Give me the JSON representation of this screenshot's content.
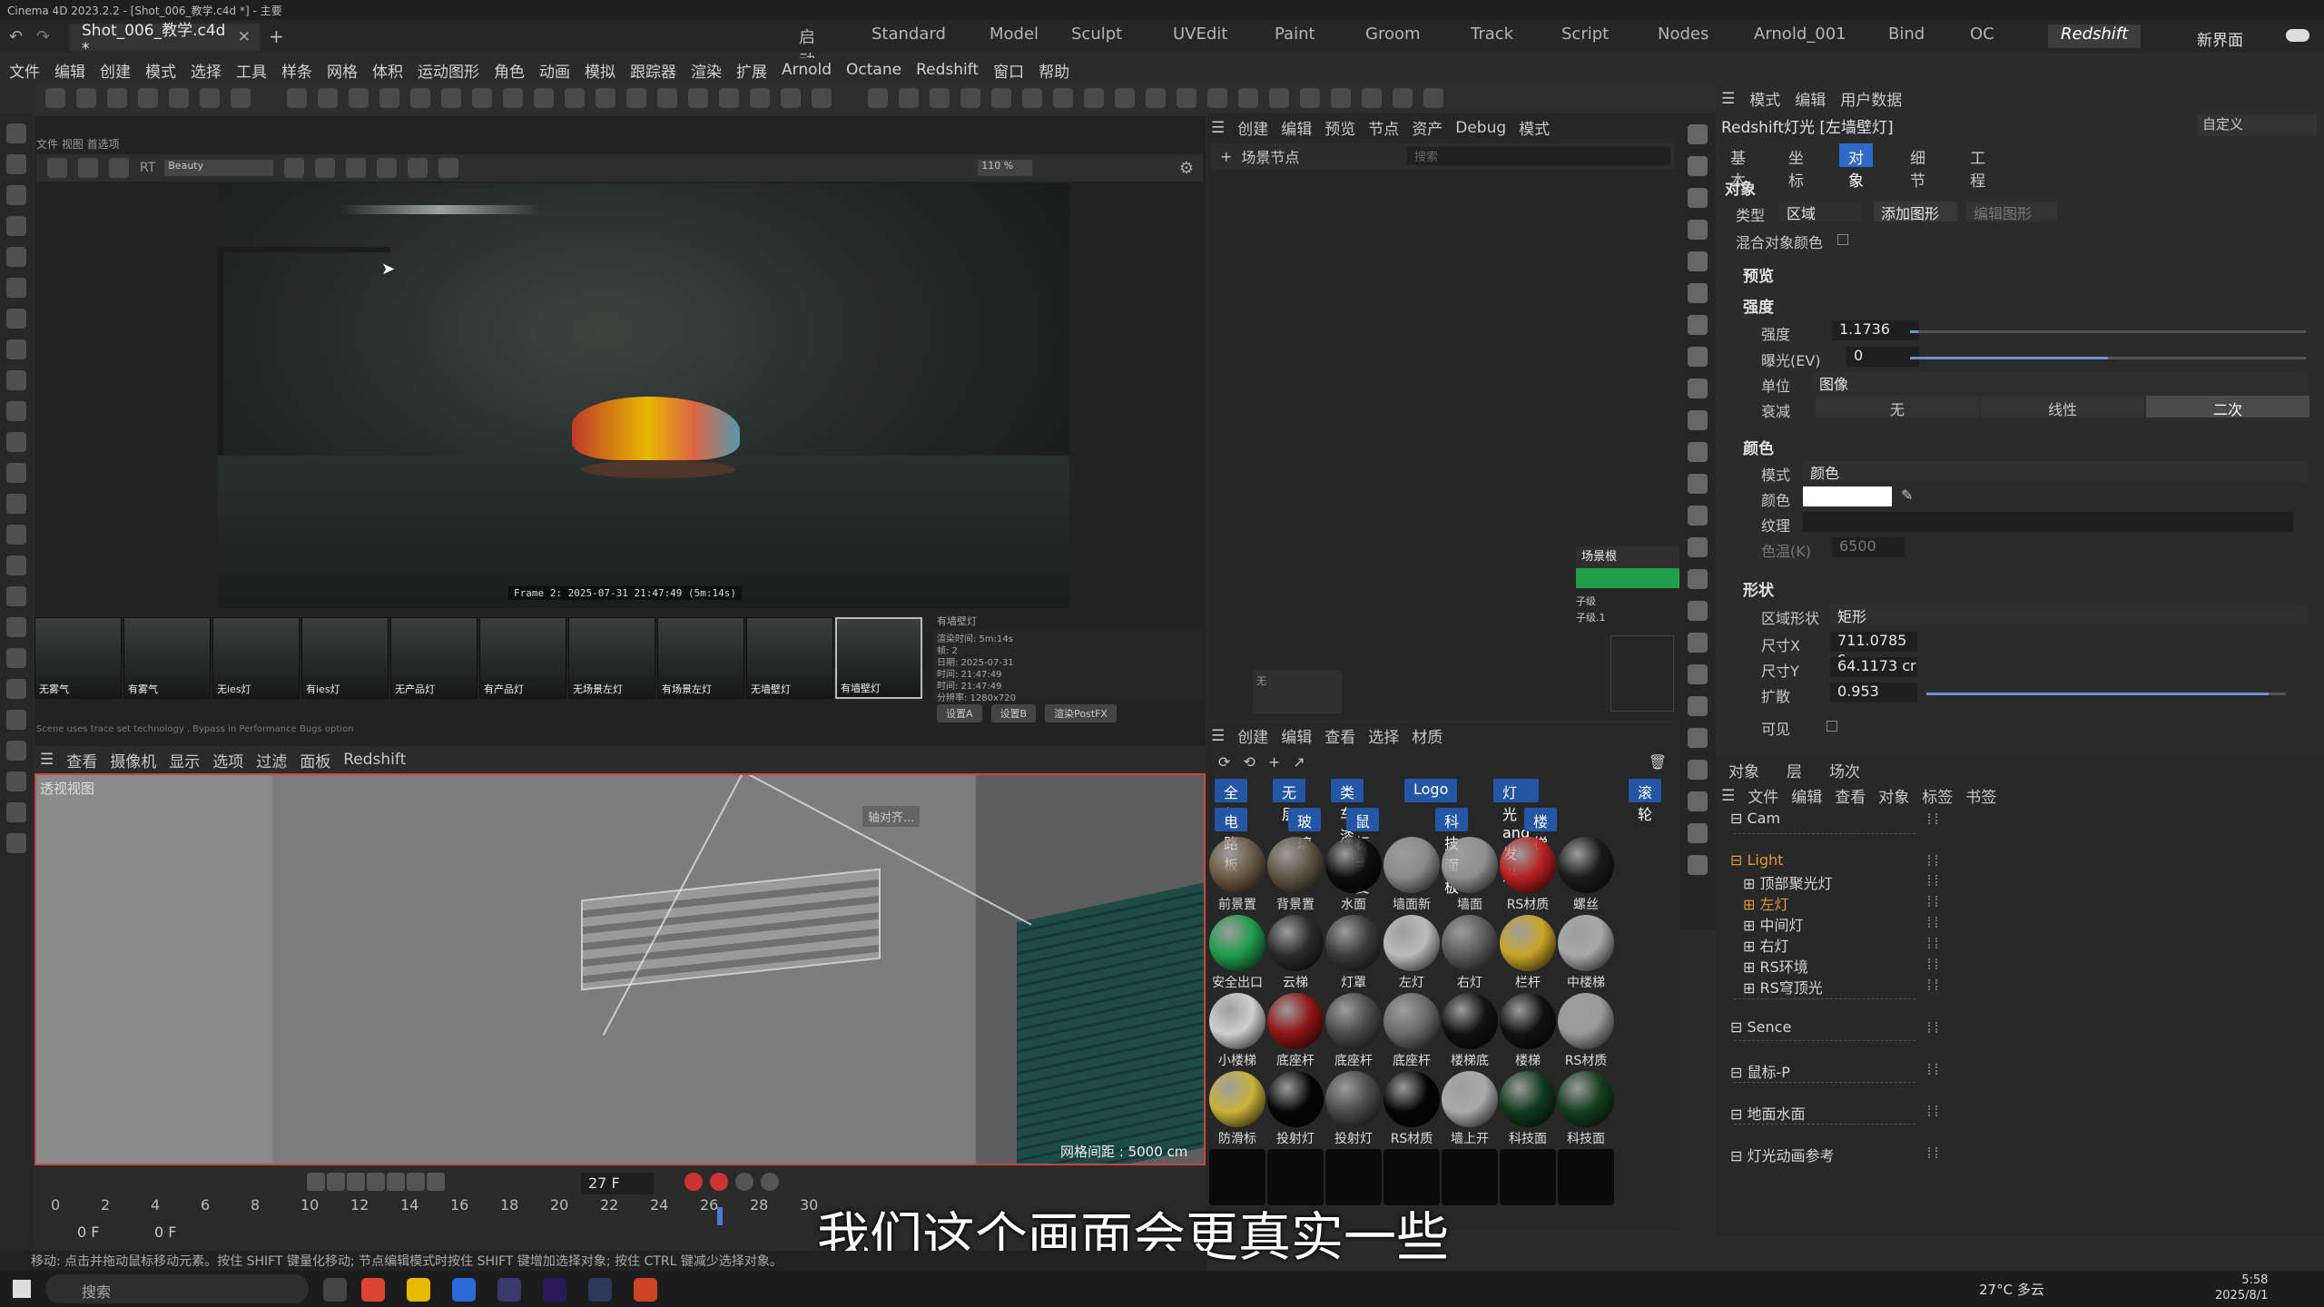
{
  "window": {
    "title": "Cinema 4D 2023.2.2 - [Shot_006_教学.c4d *] - 主要",
    "doc_tab": "Shot_006_教学.c4d *"
  },
  "layouts": [
    "启动",
    "Standard",
    "Model",
    "Sculpt",
    "UVEdit",
    "Paint",
    "Groom",
    "Track",
    "Script",
    "Nodes",
    "Arnold_001",
    "Bind",
    "OC",
    "Redshift"
  ],
  "active_layout": "Redshift",
  "new_interface": "新界面",
  "menu": [
    "文件",
    "编辑",
    "创建",
    "模式",
    "选择",
    "工具",
    "样条",
    "网格",
    "体积",
    "运动图形",
    "角色",
    "动画",
    "模拟",
    "跟踪器",
    "渲染",
    "扩展",
    "Arnold",
    "Octane",
    "Redshift",
    "窗口",
    "帮助"
  ],
  "render_view": {
    "menu": "文件 视图 首选项",
    "aov": "Beauty",
    "zoom": "110 %",
    "frame_label": "Frame  2:  2025-07-31  21:47:49  (5m:14s)",
    "snapshot_label": "有墙壁灯",
    "snapshot_info": [
      "有墙壁灯",
      "渲染时间: 5m:14s",
      "帧: 2",
      "日期: 2025-07-31",
      "时间: 21:47:49",
      "时间: 21:47:49",
      "分辨率: 1280x720"
    ],
    "snapshot_buttons": [
      "设置A",
      "设置B",
      "渲染PostFX"
    ],
    "thumbs": [
      "无雾气",
      "有雾气",
      "无ies灯",
      "有ies灯",
      "无产品灯",
      "有产品灯",
      "无场景左灯",
      "有场景左灯",
      "无墙壁灯",
      "有墙壁灯"
    ],
    "status": "Scene uses trace set technology . Bypass in Performance Bugs option"
  },
  "viewport": {
    "menu": [
      "查看",
      "摄像机",
      "显示",
      "选项",
      "过滤",
      "面板",
      "Redshift"
    ],
    "title": "透视视图",
    "axis_label": "轴对齐...",
    "grid": "网格间距 : 5000 cm"
  },
  "timeline": {
    "current_frame": "27 F",
    "ticks": [
      "0",
      "2",
      "4",
      "6",
      "8",
      "10",
      "12",
      "14",
      "16",
      "18",
      "20",
      "22",
      "24",
      "26",
      "28",
      "30"
    ],
    "start": "0 F",
    "end": "0 F"
  },
  "node_editor": {
    "menu": [
      "创建",
      "编辑",
      "预览",
      "节点",
      "资产",
      "Debug",
      "模式"
    ],
    "header": "场景节点",
    "search_placeholder": "搜索",
    "root_node": "场景根",
    "children": [
      "子级",
      "子级.1"
    ],
    "thumb_label": "无"
  },
  "material_manager": {
    "menu": [
      "创建",
      "编辑",
      "查看",
      "选择",
      "材质"
    ],
    "tabs_row1": [
      "全部",
      "无层",
      "类车漆",
      "Logo",
      "灯光and发光",
      "滚轮"
    ],
    "tabs_row2": [
      "电路板",
      "玻璃",
      "鼠标主要",
      "科技面板",
      "楼梯"
    ],
    "materials": [
      {
        "name": "前景置",
        "color": "#6b5a44"
      },
      {
        "name": "背景置",
        "color": "#5e5443"
      },
      {
        "name": "水面",
        "color": "#0d0d0d"
      },
      {
        "name": "墙面新",
        "color": "#8a8a8a"
      },
      {
        "name": "墙面",
        "color": "#909090"
      },
      {
        "name": "RS材质",
        "color": "#b51f1f"
      },
      {
        "name": "螺丝",
        "color": "#1a1a1a"
      },
      {
        "name": "安全出口",
        "color": "#1e9c4a"
      },
      {
        "name": "云梯",
        "color": "#2a2a2a"
      },
      {
        "name": "灯罩",
        "color": "#3a3a3a"
      },
      {
        "name": "左灯",
        "color": "#bcbcbc"
      },
      {
        "name": "右灯",
        "color": "#5a5a5a"
      },
      {
        "name": "栏杆",
        "color": "#c9a326"
      },
      {
        "name": "中楼梯",
        "color": "#a8a8a8"
      },
      {
        "name": "小楼梯",
        "color": "#cfcfcf"
      },
      {
        "name": "底座杆",
        "color": "#8f1414"
      },
      {
        "name": "底座杆",
        "color": "#4a4a4a"
      },
      {
        "name": "底座杆",
        "color": "#6a6a6a"
      },
      {
        "name": "楼梯底",
        "color": "#121212"
      },
      {
        "name": "楼梯",
        "color": "#111111"
      },
      {
        "name": "RS材质",
        "color": "#9a9a9a"
      },
      {
        "name": "防滑标",
        "color": "#c9b23a"
      },
      {
        "name": "投射灯",
        "color": "#050505"
      },
      {
        "name": "投射灯",
        "color": "#4a4a4a"
      },
      {
        "name": "RS材质",
        "color": "#050505"
      },
      {
        "name": "墙上开",
        "color": "#aaaaaa"
      },
      {
        "name": "科技面",
        "color": "#123a1c"
      },
      {
        "name": "科技面",
        "color": "#143e1e"
      }
    ]
  },
  "attributes": {
    "menu": [
      "模式",
      "编辑",
      "用户数据"
    ],
    "title": "Redshift灯光 [左墙壁灯]",
    "preset": "自定义",
    "tabs": [
      "基本",
      "坐标",
      "对象",
      "细节",
      "工程"
    ],
    "active_tab": "对象",
    "section_object": "对象",
    "type_label": "类型",
    "type_value": "区域",
    "add_shape": "添加图形",
    "edit_shape": "编辑图形",
    "mix_color": "混合对象颜色",
    "preview": "预览",
    "intensity_section": "强度",
    "intensity_label": "强度",
    "intensity_value": "1.1736",
    "intensity_fill": 0.02,
    "exposure_label": "曝光(EV)",
    "exposure_value": "0",
    "exposure_fill": 0.5,
    "unit_label": "单位",
    "unit_value": "图像",
    "decay_label": "衰减",
    "decay_options": [
      "无",
      "线性",
      "二次"
    ],
    "decay_active": "二次",
    "color_section": "颜色",
    "mode_label": "模式",
    "mode_value": "颜色",
    "color_label": "颜色",
    "color_value": "#ffffff",
    "texture_label": "纹理",
    "temp_label": "色温(K)",
    "temp_value": "6500",
    "shape_section": "形状",
    "area_shape_label": "区域形状",
    "area_shape_value": "矩形",
    "sizex_label": "尺寸X",
    "sizex_value": "711.0785 c",
    "sizey_label": "尺寸Y",
    "sizey_value": "64.1173 cr",
    "spread_label": "扩散",
    "spread_value": "0.953",
    "spread_fill": 0.953,
    "visible_label": "可见"
  },
  "objects": {
    "tabs": [
      "对象",
      "层",
      "场次"
    ],
    "menu": [
      "文件",
      "编辑",
      "查看",
      "对象",
      "标签",
      "书签"
    ],
    "items": [
      {
        "name": "Cam",
        "indent": 0,
        "orange": false
      },
      {
        "name": "Light",
        "indent": 0,
        "orange": true
      },
      {
        "name": "顶部聚光灯",
        "indent": 1,
        "orange": false
      },
      {
        "name": "左灯",
        "indent": 1,
        "orange": true
      },
      {
        "name": "中间灯",
        "indent": 1,
        "orange": false
      },
      {
        "name": "右灯",
        "indent": 1,
        "orange": false
      },
      {
        "name": "RS环境",
        "indent": 1,
        "orange": false
      },
      {
        "name": "RS穹顶光",
        "indent": 1,
        "orange": false
      },
      {
        "name": "Sence",
        "indent": 0,
        "orange": false
      },
      {
        "name": "鼠标-P",
        "indent": 0,
        "orange": false
      },
      {
        "name": "地面水面",
        "indent": 0,
        "orange": false
      },
      {
        "name": "灯光动画参考",
        "indent": 0,
        "orange": false
      }
    ]
  },
  "subtitle": "我们这个画面会更真实一些",
  "statusline": "移动: 点击并拖动鼠标移动元素。按住 SHIFT 键量化移动; 节点编辑模式时按住 SHIFT 键增加选择对象; 按住 CTRL 键减少选择对象。",
  "taskbar": {
    "search": "搜索",
    "weather": "27°C 多云",
    "time": "5:58",
    "date": "2025/8/1"
  }
}
